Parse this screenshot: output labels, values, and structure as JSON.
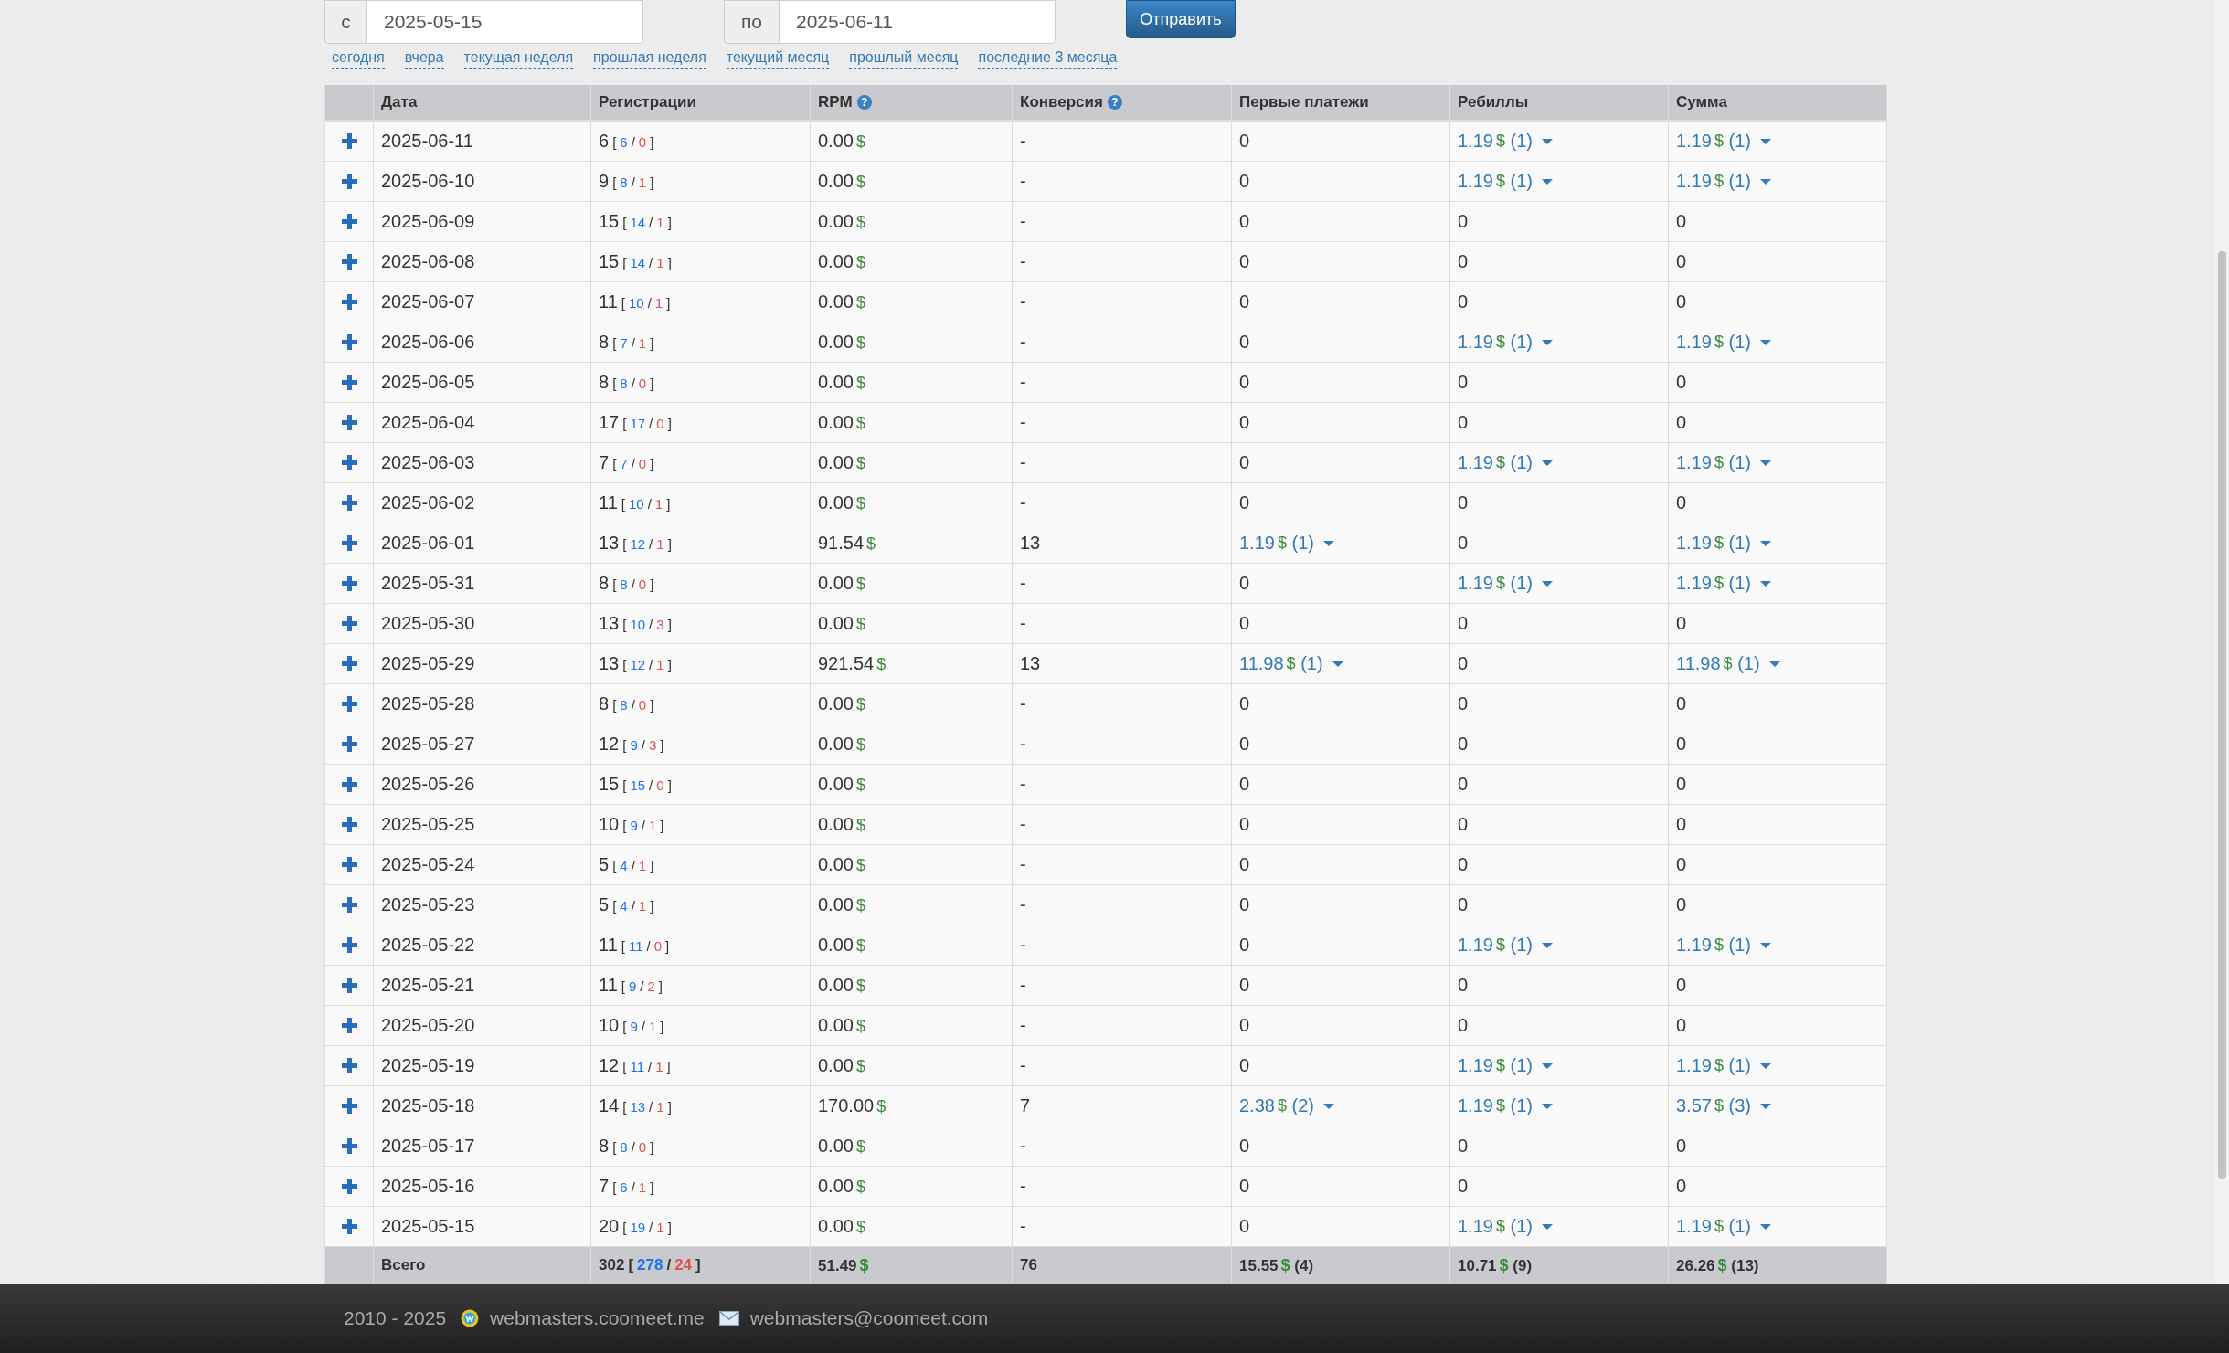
{
  "filter": {
    "from_label": "с",
    "from_value": "2025-05-15",
    "to_label": "по",
    "to_value": "2025-06-11",
    "submit": "Отправить",
    "presets": [
      "сегодня",
      "вчера",
      "текущая неделя",
      "прошлая неделя",
      "текущий месяц",
      "прошлый месяц",
      "последние 3 месяца"
    ]
  },
  "table": {
    "columns": [
      {
        "label": "Дата"
      },
      {
        "label": "Регистрации"
      },
      {
        "label": "RPM",
        "help_icon": "?"
      },
      {
        "label": "Конверсия",
        "help_icon": "?"
      },
      {
        "label": "Первые платежи"
      },
      {
        "label": "Ребиллы"
      },
      {
        "label": "Сумма"
      }
    ],
    "rows": [
      {
        "date": "2025-06-11",
        "reg": [
          "6",
          "[",
          "6",
          "/",
          "0",
          "]"
        ],
        "rpm": [
          "0.00",
          "$"
        ],
        "conversion": "-",
        "first_payments": {
          "kind": "plain",
          "amount": "0"
        },
        "rebills": {
          "kind": "dropdown",
          "amount": "1.19",
          "currency": "$",
          "count": "(1)"
        },
        "sum": {
          "kind": "dropdown",
          "amount": "1.19",
          "currency": "$",
          "count": "(1)"
        }
      },
      {
        "date": "2025-06-10",
        "reg": [
          "9",
          "[",
          "8",
          "/",
          "1",
          "]"
        ],
        "rpm": [
          "0.00",
          "$"
        ],
        "conversion": "-",
        "first_payments": {
          "kind": "plain",
          "amount": "0"
        },
        "rebills": {
          "kind": "dropdown",
          "amount": "1.19",
          "currency": "$",
          "count": "(1)"
        },
        "sum": {
          "kind": "dropdown",
          "amount": "1.19",
          "currency": "$",
          "count": "(1)"
        }
      },
      {
        "date": "2025-06-09",
        "reg": [
          "15",
          "[",
          "14",
          "/",
          "1",
          "]"
        ],
        "rpm": [
          "0.00",
          "$"
        ],
        "conversion": "-",
        "first_payments": {
          "kind": "plain",
          "amount": "0"
        },
        "rebills": {
          "kind": "plain",
          "amount": "0"
        },
        "sum": {
          "kind": "plain",
          "amount": "0"
        }
      },
      {
        "date": "2025-06-08",
        "reg": [
          "15",
          "[",
          "14",
          "/",
          "1",
          "]"
        ],
        "rpm": [
          "0.00",
          "$"
        ],
        "conversion": "-",
        "first_payments": {
          "kind": "plain",
          "amount": "0"
        },
        "rebills": {
          "kind": "plain",
          "amount": "0"
        },
        "sum": {
          "kind": "plain",
          "amount": "0"
        }
      },
      {
        "date": "2025-06-07",
        "reg": [
          "11",
          "[",
          "10",
          "/",
          "1",
          "]"
        ],
        "rpm": [
          "0.00",
          "$"
        ],
        "conversion": "-",
        "first_payments": {
          "kind": "plain",
          "amount": "0"
        },
        "rebills": {
          "kind": "plain",
          "amount": "0"
        },
        "sum": {
          "kind": "plain",
          "amount": "0"
        }
      },
      {
        "date": "2025-06-06",
        "reg": [
          "8",
          "[",
          "7",
          "/",
          "1",
          "]"
        ],
        "rpm": [
          "0.00",
          "$"
        ],
        "conversion": "-",
        "first_payments": {
          "kind": "plain",
          "amount": "0"
        },
        "rebills": {
          "kind": "dropdown",
          "amount": "1.19",
          "currency": "$",
          "count": "(1)"
        },
        "sum": {
          "kind": "dropdown",
          "amount": "1.19",
          "currency": "$",
          "count": "(1)"
        }
      },
      {
        "date": "2025-06-05",
        "reg": [
          "8",
          "[",
          "8",
          "/",
          "0",
          "]"
        ],
        "rpm": [
          "0.00",
          "$"
        ],
        "conversion": "-",
        "first_payments": {
          "kind": "plain",
          "amount": "0"
        },
        "rebills": {
          "kind": "plain",
          "amount": "0"
        },
        "sum": {
          "kind": "plain",
          "amount": "0"
        }
      },
      {
        "date": "2025-06-04",
        "reg": [
          "17",
          "[",
          "17",
          "/",
          "0",
          "]"
        ],
        "rpm": [
          "0.00",
          "$"
        ],
        "conversion": "-",
        "first_payments": {
          "kind": "plain",
          "amount": "0"
        },
        "rebills": {
          "kind": "plain",
          "amount": "0"
        },
        "sum": {
          "kind": "plain",
          "amount": "0"
        }
      },
      {
        "date": "2025-06-03",
        "reg": [
          "7",
          "[",
          "7",
          "/",
          "0",
          "]"
        ],
        "rpm": [
          "0.00",
          "$"
        ],
        "conversion": "-",
        "first_payments": {
          "kind": "plain",
          "amount": "0"
        },
        "rebills": {
          "kind": "dropdown",
          "amount": "1.19",
          "currency": "$",
          "count": "(1)"
        },
        "sum": {
          "kind": "dropdown",
          "amount": "1.19",
          "currency": "$",
          "count": "(1)"
        }
      },
      {
        "date": "2025-06-02",
        "reg": [
          "11",
          "[",
          "10",
          "/",
          "1",
          "]"
        ],
        "rpm": [
          "0.00",
          "$"
        ],
        "conversion": "-",
        "first_payments": {
          "kind": "plain",
          "amount": "0"
        },
        "rebills": {
          "kind": "plain",
          "amount": "0"
        },
        "sum": {
          "kind": "plain",
          "amount": "0"
        }
      },
      {
        "date": "2025-06-01",
        "reg": [
          "13",
          "[",
          "12",
          "/",
          "1",
          "]"
        ],
        "rpm": [
          "91.54",
          "$"
        ],
        "conversion": "13",
        "first_payments": {
          "kind": "dropdown",
          "amount": "1.19",
          "currency": "$",
          "count": "(1)"
        },
        "rebills": {
          "kind": "plain",
          "amount": "0"
        },
        "sum": {
          "kind": "dropdown",
          "amount": "1.19",
          "currency": "$",
          "count": "(1)"
        }
      },
      {
        "date": "2025-05-31",
        "reg": [
          "8",
          "[",
          "8",
          "/",
          "0",
          "]"
        ],
        "rpm": [
          "0.00",
          "$"
        ],
        "conversion": "-",
        "first_payments": {
          "kind": "plain",
          "amount": "0"
        },
        "rebills": {
          "kind": "dropdown",
          "amount": "1.19",
          "currency": "$",
          "count": "(1)"
        },
        "sum": {
          "kind": "dropdown",
          "amount": "1.19",
          "currency": "$",
          "count": "(1)"
        }
      },
      {
        "date": "2025-05-30",
        "reg": [
          "13",
          "[",
          "10",
          "/",
          "3",
          "]"
        ],
        "rpm": [
          "0.00",
          "$"
        ],
        "conversion": "-",
        "first_payments": {
          "kind": "plain",
          "amount": "0"
        },
        "rebills": {
          "kind": "plain",
          "amount": "0"
        },
        "sum": {
          "kind": "plain",
          "amount": "0"
        }
      },
      {
        "date": "2025-05-29",
        "reg": [
          "13",
          "[",
          "12",
          "/",
          "1",
          "]"
        ],
        "rpm": [
          "921.54",
          "$"
        ],
        "conversion": "13",
        "first_payments": {
          "kind": "dropdown",
          "amount": "11.98",
          "currency": "$",
          "count": "(1)"
        },
        "rebills": {
          "kind": "plain",
          "amount": "0"
        },
        "sum": {
          "kind": "dropdown",
          "amount": "11.98",
          "currency": "$",
          "count": "(1)"
        }
      },
      {
        "date": "2025-05-28",
        "reg": [
          "8",
          "[",
          "8",
          "/",
          "0",
          "]"
        ],
        "rpm": [
          "0.00",
          "$"
        ],
        "conversion": "-",
        "first_payments": {
          "kind": "plain",
          "amount": "0"
        },
        "rebills": {
          "kind": "plain",
          "amount": "0"
        },
        "sum": {
          "kind": "plain",
          "amount": "0"
        }
      },
      {
        "date": "2025-05-27",
        "reg": [
          "12",
          "[",
          "9",
          "/",
          "3",
          "]"
        ],
        "rpm": [
          "0.00",
          "$"
        ],
        "conversion": "-",
        "first_payments": {
          "kind": "plain",
          "amount": "0"
        },
        "rebills": {
          "kind": "plain",
          "amount": "0"
        },
        "sum": {
          "kind": "plain",
          "amount": "0"
        }
      },
      {
        "date": "2025-05-26",
        "reg": [
          "15",
          "[",
          "15",
          "/",
          "0",
          "]"
        ],
        "rpm": [
          "0.00",
          "$"
        ],
        "conversion": "-",
        "first_payments": {
          "kind": "plain",
          "amount": "0"
        },
        "rebills": {
          "kind": "plain",
          "amount": "0"
        },
        "sum": {
          "kind": "plain",
          "amount": "0"
        }
      },
      {
        "date": "2025-05-25",
        "reg": [
          "10",
          "[",
          "9",
          "/",
          "1",
          "]"
        ],
        "rpm": [
          "0.00",
          "$"
        ],
        "conversion": "-",
        "first_payments": {
          "kind": "plain",
          "amount": "0"
        },
        "rebills": {
          "kind": "plain",
          "amount": "0"
        },
        "sum": {
          "kind": "plain",
          "amount": "0"
        }
      },
      {
        "date": "2025-05-24",
        "reg": [
          "5",
          "[",
          "4",
          "/",
          "1",
          "]"
        ],
        "rpm": [
          "0.00",
          "$"
        ],
        "conversion": "-",
        "first_payments": {
          "kind": "plain",
          "amount": "0"
        },
        "rebills": {
          "kind": "plain",
          "amount": "0"
        },
        "sum": {
          "kind": "plain",
          "amount": "0"
        }
      },
      {
        "date": "2025-05-23",
        "reg": [
          "5",
          "[",
          "4",
          "/",
          "1",
          "]"
        ],
        "rpm": [
          "0.00",
          "$"
        ],
        "conversion": "-",
        "first_payments": {
          "kind": "plain",
          "amount": "0"
        },
        "rebills": {
          "kind": "plain",
          "amount": "0"
        },
        "sum": {
          "kind": "plain",
          "amount": "0"
        }
      },
      {
        "date": "2025-05-22",
        "reg": [
          "11",
          "[",
          "11",
          "/",
          "0",
          "]"
        ],
        "rpm": [
          "0.00",
          "$"
        ],
        "conversion": "-",
        "first_payments": {
          "kind": "plain",
          "amount": "0"
        },
        "rebills": {
          "kind": "dropdown",
          "amount": "1.19",
          "currency": "$",
          "count": "(1)"
        },
        "sum": {
          "kind": "dropdown",
          "amount": "1.19",
          "currency": "$",
          "count": "(1)"
        }
      },
      {
        "date": "2025-05-21",
        "reg": [
          "11",
          "[",
          "9",
          "/",
          "2",
          "]"
        ],
        "rpm": [
          "0.00",
          "$"
        ],
        "conversion": "-",
        "first_payments": {
          "kind": "plain",
          "amount": "0"
        },
        "rebills": {
          "kind": "plain",
          "amount": "0"
        },
        "sum": {
          "kind": "plain",
          "amount": "0"
        }
      },
      {
        "date": "2025-05-20",
        "reg": [
          "10",
          "[",
          "9",
          "/",
          "1",
          "]"
        ],
        "rpm": [
          "0.00",
          "$"
        ],
        "conversion": "-",
        "first_payments": {
          "kind": "plain",
          "amount": "0"
        },
        "rebills": {
          "kind": "plain",
          "amount": "0"
        },
        "sum": {
          "kind": "plain",
          "amount": "0"
        }
      },
      {
        "date": "2025-05-19",
        "reg": [
          "12",
          "[",
          "11",
          "/",
          "1",
          "]"
        ],
        "rpm": [
          "0.00",
          "$"
        ],
        "conversion": "-",
        "first_payments": {
          "kind": "plain",
          "amount": "0"
        },
        "rebills": {
          "kind": "dropdown",
          "amount": "1.19",
          "currency": "$",
          "count": "(1)"
        },
        "sum": {
          "kind": "dropdown",
          "amount": "1.19",
          "currency": "$",
          "count": "(1)"
        }
      },
      {
        "date": "2025-05-18",
        "reg": [
          "14",
          "[",
          "13",
          "/",
          "1",
          "]"
        ],
        "rpm": [
          "170.00",
          "$"
        ],
        "conversion": "7",
        "first_payments": {
          "kind": "dropdown",
          "amount": "2.38",
          "currency": "$",
          "count": "(2)"
        },
        "rebills": {
          "kind": "dropdown",
          "amount": "1.19",
          "currency": "$",
          "count": "(1)"
        },
        "sum": {
          "kind": "dropdown",
          "amount": "3.57",
          "currency": "$",
          "count": "(3)"
        }
      },
      {
        "date": "2025-05-17",
        "reg": [
          "8",
          "[",
          "8",
          "/",
          "0",
          "]"
        ],
        "rpm": [
          "0.00",
          "$"
        ],
        "conversion": "-",
        "first_payments": {
          "kind": "plain",
          "amount": "0"
        },
        "rebills": {
          "kind": "plain",
          "amount": "0"
        },
        "sum": {
          "kind": "plain",
          "amount": "0"
        }
      },
      {
        "date": "2025-05-16",
        "reg": [
          "7",
          "[",
          "6",
          "/",
          "1",
          "]"
        ],
        "rpm": [
          "0.00",
          "$"
        ],
        "conversion": "-",
        "first_payments": {
          "kind": "plain",
          "amount": "0"
        },
        "rebills": {
          "kind": "plain",
          "amount": "0"
        },
        "sum": {
          "kind": "plain",
          "amount": "0"
        }
      },
      {
        "date": "2025-05-15",
        "reg": [
          "20",
          "[",
          "19",
          "/",
          "1",
          "]"
        ],
        "rpm": [
          "0.00",
          "$"
        ],
        "conversion": "-",
        "first_payments": {
          "kind": "plain",
          "amount": "0"
        },
        "rebills": {
          "kind": "dropdown",
          "amount": "1.19",
          "currency": "$",
          "count": "(1)"
        },
        "sum": {
          "kind": "dropdown",
          "amount": "1.19",
          "currency": "$",
          "count": "(1)"
        }
      }
    ],
    "total": {
      "label": "Всего",
      "reg": [
        "302",
        "[",
        "278",
        "/",
        "24",
        "]"
      ],
      "rpm": [
        "51.49",
        "$"
      ],
      "conversion": "76",
      "first_payments": {
        "kind": "total",
        "amount": "15.55",
        "currency": "$",
        "count": "(4)"
      },
      "rebills": {
        "kind": "total",
        "amount": "10.71",
        "currency": "$",
        "count": "(9)"
      },
      "sum": {
        "kind": "total",
        "amount": "26.26",
        "currency": "$",
        "count": "(13)"
      }
    }
  },
  "footer": {
    "years": "2010 - 2025",
    "site": "webmasters.coomeet.me",
    "email": "webmasters@coomeet.com"
  }
}
